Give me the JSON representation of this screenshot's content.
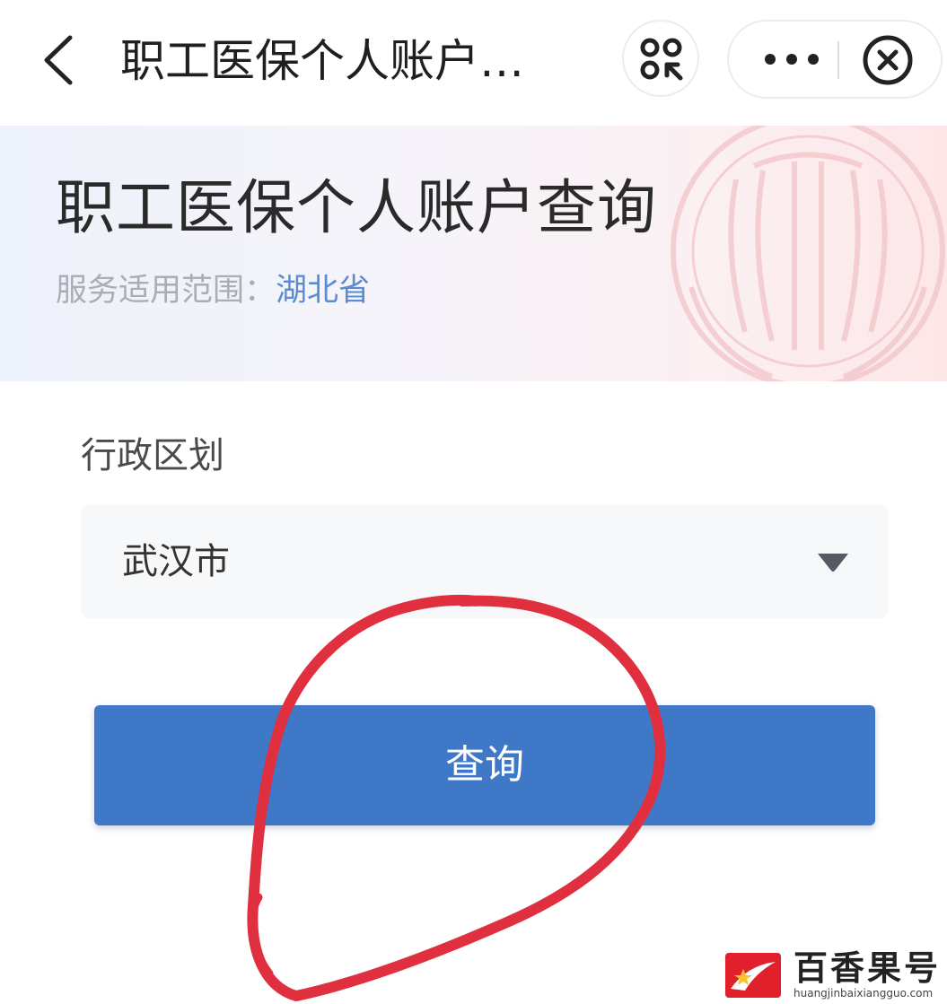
{
  "nav": {
    "title": "职工医保个人账户…",
    "icons": {
      "back": "chevron-left-icon",
      "scan": "scan-icon",
      "more": "more-dots-icon",
      "close": "close-circle-icon"
    }
  },
  "banner": {
    "title": "职工医保个人账户查询",
    "scope_label": "服务适用范围：",
    "scope_value": "湖北省"
  },
  "form": {
    "region_label": "行政区划",
    "region_value": "武汉市",
    "submit_label": "查询"
  },
  "watermark": {
    "brand": "百香果号",
    "url": "huangjinbaixiangguo.com"
  },
  "colors": {
    "primary_button": "#3f78c6",
    "annotation": "#e0303f",
    "scope_link": "#5b8bd0"
  }
}
